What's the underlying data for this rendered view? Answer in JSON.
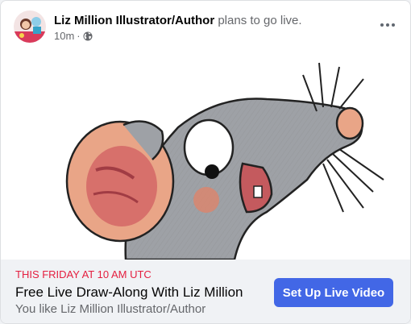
{
  "post": {
    "author": "Liz Million Illustrator/Author",
    "action": "plans to go live.",
    "time": "10m",
    "separator": "·",
    "audience_icon": "globe-icon",
    "more_icon": "more-options-icon"
  },
  "event": {
    "time_label": "THIS FRIDAY AT 10 AM UTC",
    "title": "Free Live Draw-Along With Liz Million",
    "subtitle": "You like Liz Million Illustrator/Author",
    "cta_label": "Set Up Live Video"
  },
  "colors": {
    "cta": "#4267e6",
    "event_time": "#e41e3f",
    "footer_bg": "#f0f2f5"
  }
}
